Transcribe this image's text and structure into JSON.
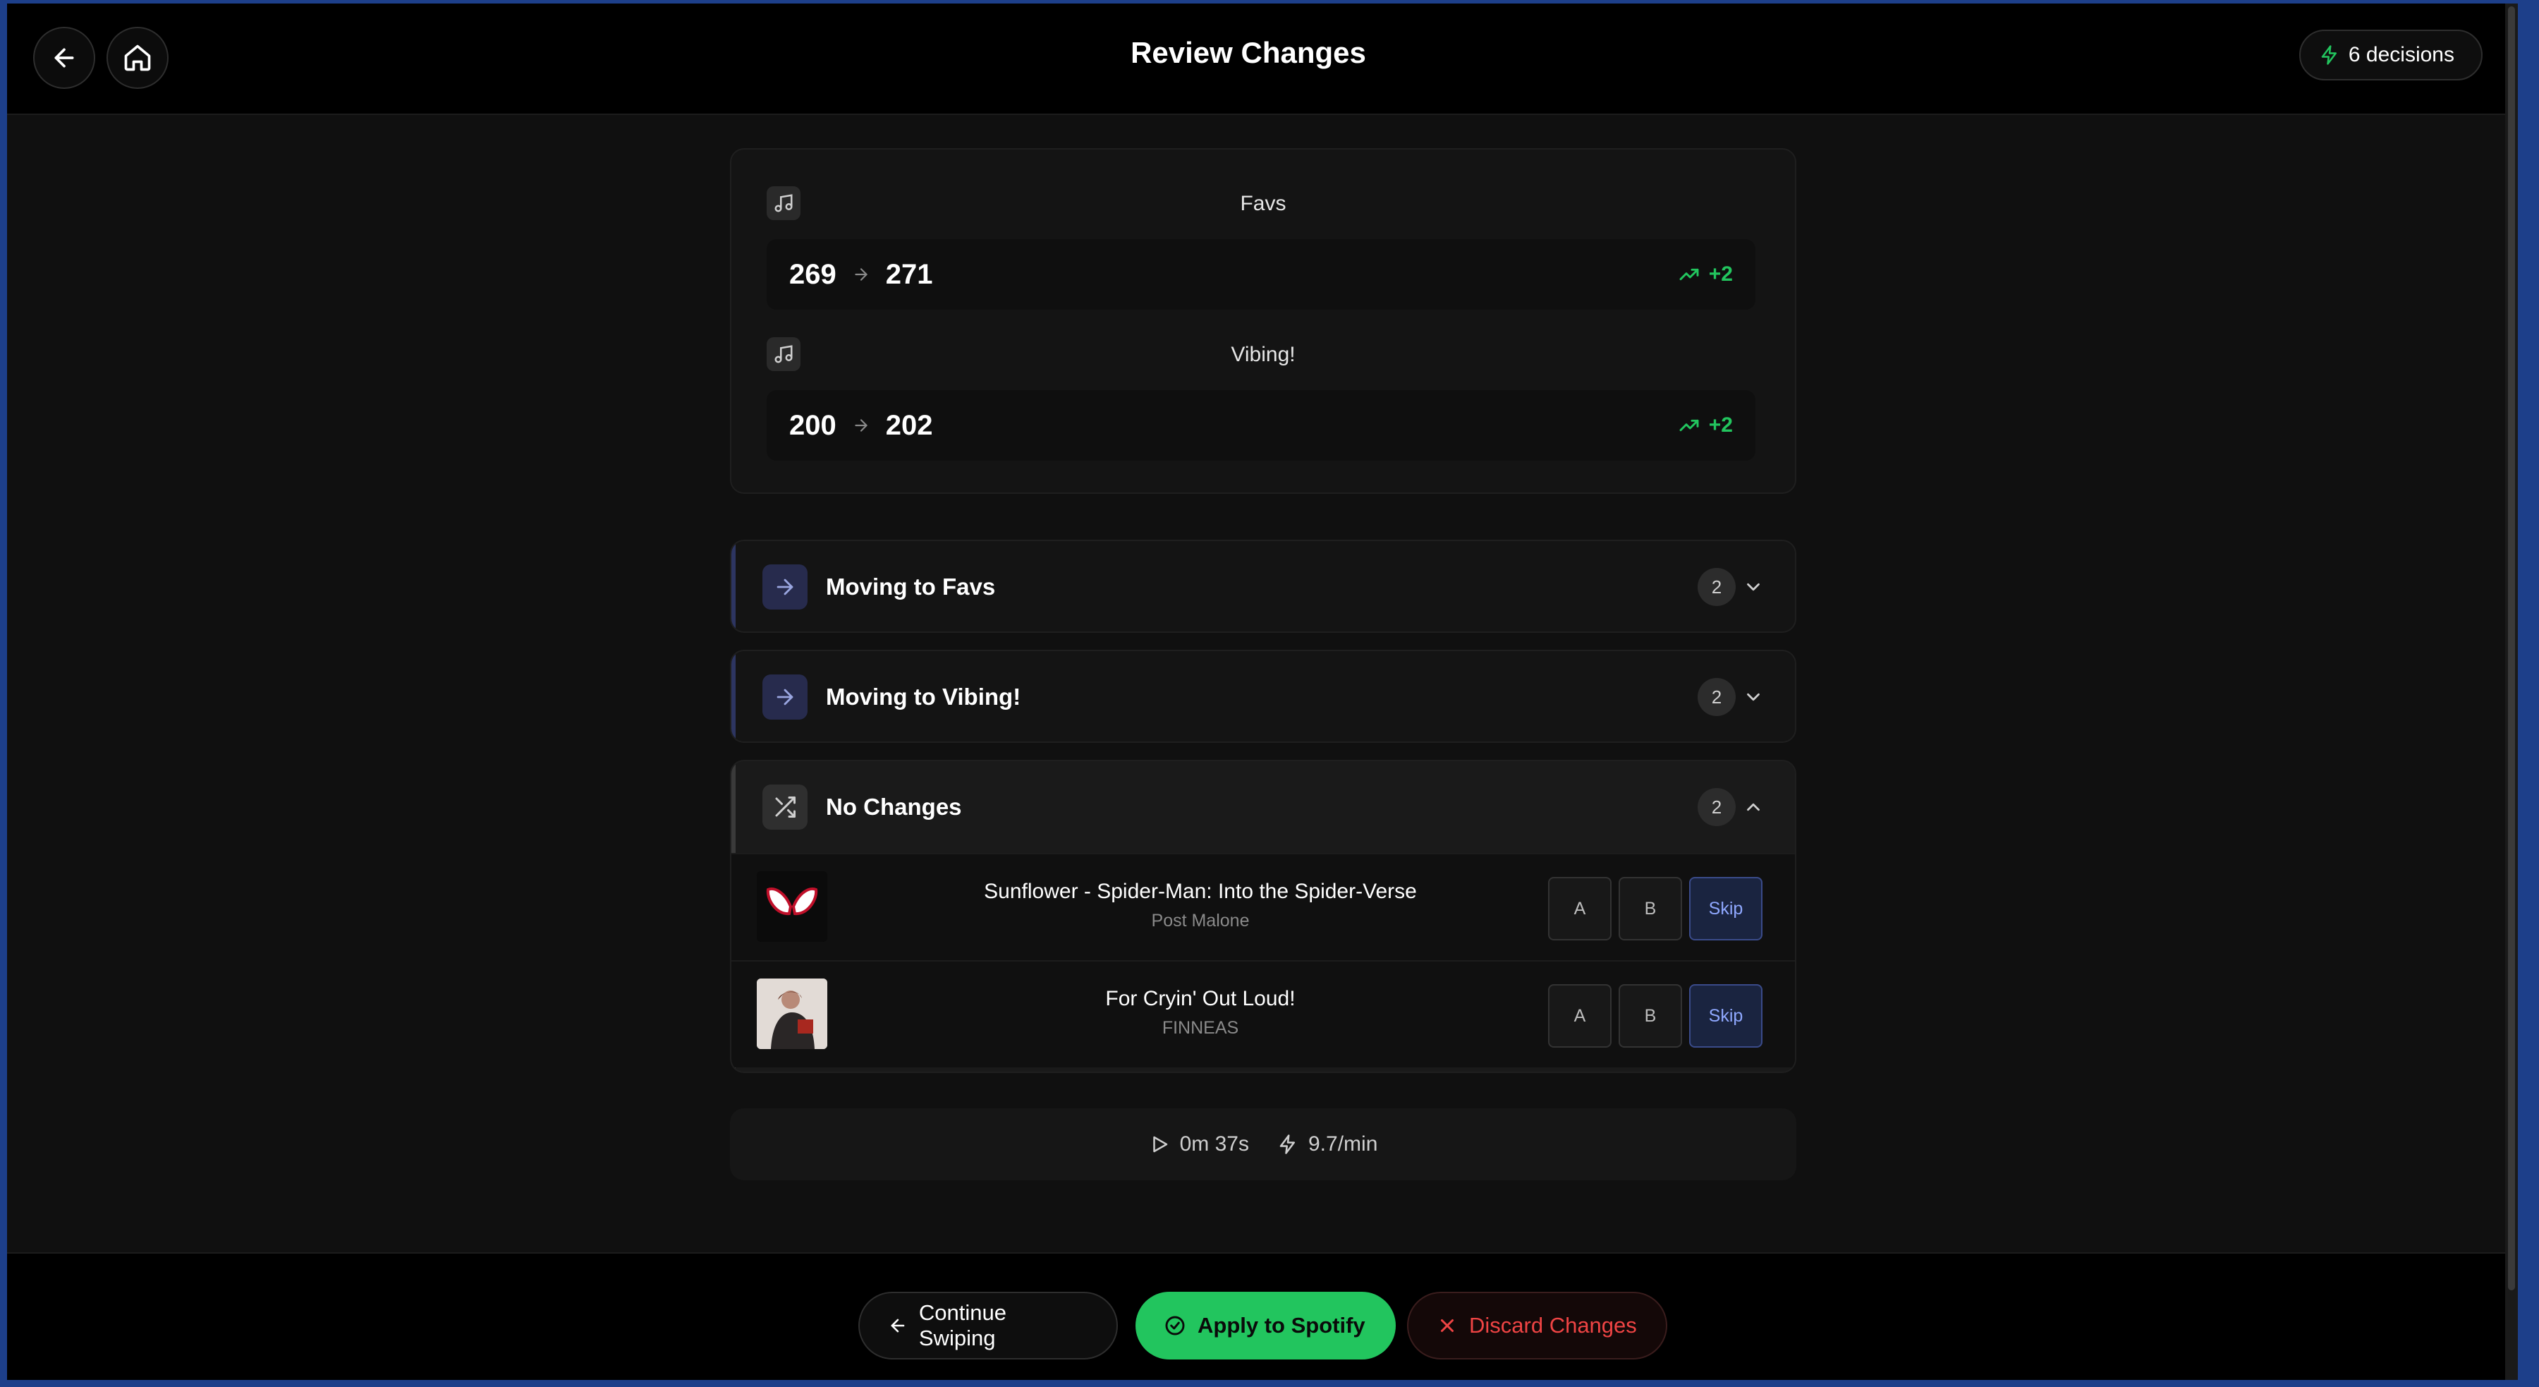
{
  "header": {
    "title": "Review Changes",
    "decisions_label": "6 decisions"
  },
  "playlists": [
    {
      "name": "Favs",
      "from": "269",
      "to": "271",
      "delta": "+2"
    },
    {
      "name": "Vibing!",
      "from": "200",
      "to": "202",
      "delta": "+2"
    }
  ],
  "groups": [
    {
      "title": "Moving to Favs",
      "count": "2",
      "expanded": false
    },
    {
      "title": "Moving to Vibing!",
      "count": "2",
      "expanded": false
    },
    {
      "title": "No Changes",
      "count": "2",
      "expanded": true
    }
  ],
  "tracks": [
    {
      "title": "Sunflower - Spider-Man: Into the Spider-Verse",
      "artist": "Post Malone",
      "a": "A",
      "b": "B",
      "skip": "Skip"
    },
    {
      "title": "For Cryin' Out Loud!",
      "artist": "FINNEAS",
      "a": "A",
      "b": "B",
      "skip": "Skip"
    }
  ],
  "stats": {
    "time": "0m 37s",
    "rate": "9.7/min"
  },
  "footer": {
    "continue_label": "Continue Swiping",
    "apply_label": "Apply to Spotify",
    "discard_label": "Discard Changes"
  },
  "colors": {
    "accent_green": "#22c55e",
    "danger_red": "#ef4444",
    "skip_blue": "#8fa8ff",
    "group_accent": "#2d3561"
  }
}
